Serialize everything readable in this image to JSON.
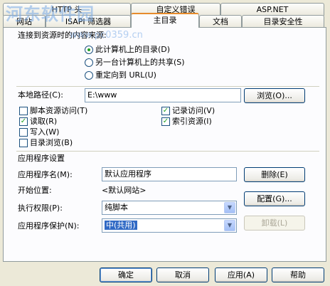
{
  "tabs_row1": [
    {
      "label": "HTTP 头"
    },
    {
      "label": "自定义错误"
    },
    {
      "label": "ASP.NET"
    }
  ],
  "tabs_row2": [
    {
      "label": "网站"
    },
    {
      "label": "ISAPI 筛选器"
    },
    {
      "label": "主目录"
    },
    {
      "label": "文档"
    },
    {
      "label": "目录安全性"
    }
  ],
  "watermark": {
    "text": "河东软件园",
    "url": "www.pc0359.cn"
  },
  "content_source": {
    "heading": "连接到资源时的内容来源:",
    "options": [
      {
        "label": "此计算机上的目录(D)",
        "selected": true
      },
      {
        "label": "另一台计算机上的共享(S)",
        "selected": false
      },
      {
        "label": "重定向到 URL(U)",
        "selected": false
      }
    ]
  },
  "local_path": {
    "label": "本地路径(C):",
    "value": "E:\\www",
    "browse_label": "浏览(O)..."
  },
  "permissions": {
    "left": [
      {
        "label": "脚本资源访问(T)",
        "checked": false
      },
      {
        "label": "读取(R)",
        "checked": true
      },
      {
        "label": "写入(W)",
        "checked": false
      },
      {
        "label": "目录浏览(B)",
        "checked": false
      }
    ],
    "right": [
      {
        "label": "记录访问(V)",
        "checked": true
      },
      {
        "label": "索引资源(I)",
        "checked": true
      }
    ]
  },
  "app_settings": {
    "heading": "应用程序设置",
    "name_label": "应用程序名(M):",
    "name_value": "默认应用程序",
    "remove_label": "删除(E)",
    "start_label": "开始位置:",
    "start_value": "<默认网站>",
    "config_label": "配置(G)...",
    "exec_label": "执行权限(P):",
    "exec_value": "纯脚本",
    "protect_label": "应用程序保护(N):",
    "protect_value": "中(共用)",
    "unload_label": "卸载(L)"
  },
  "footer": {
    "ok": "确定",
    "cancel": "取消",
    "apply": "应用(A)",
    "help": "帮助"
  }
}
